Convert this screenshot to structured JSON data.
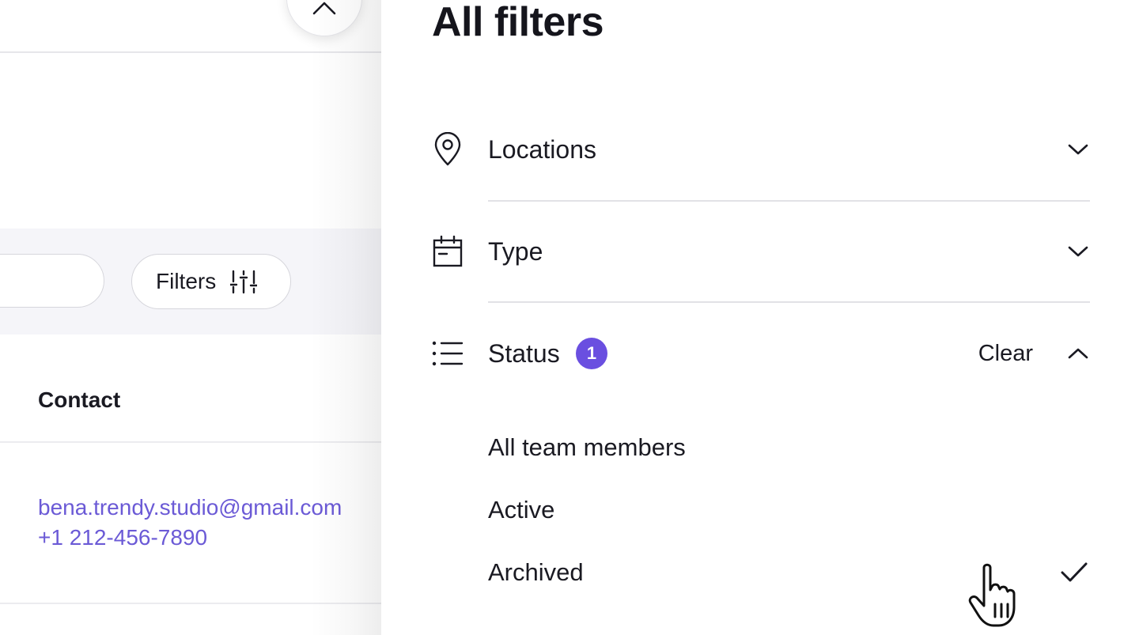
{
  "background": {
    "toolbar": {
      "filters_label": "Filters"
    },
    "table": {
      "columns": [
        "Contact"
      ],
      "rows": [
        {
          "email": "bena.trendy.studio@gmail.com",
          "phone": "+1 212-456-7890"
        }
      ]
    },
    "colors": {
      "link": "#6b5ad6",
      "band": "#f5f5f9"
    }
  },
  "drawer": {
    "title": "All filters",
    "sections": [
      {
        "label": "Locations",
        "icon": "map-pin-icon",
        "expanded": false
      },
      {
        "label": "Type",
        "icon": "calendar-icon",
        "expanded": false
      },
      {
        "label": "Status",
        "icon": "list-icon",
        "expanded": true,
        "badge": "1",
        "clear_label": "Clear"
      }
    ],
    "status_options": [
      {
        "label": "All team members",
        "selected": false
      },
      {
        "label": "Active",
        "selected": false
      },
      {
        "label": "Archived",
        "selected": true
      }
    ],
    "colors": {
      "badge": "#6a4fe0",
      "divider": "#e2e2e6"
    }
  }
}
